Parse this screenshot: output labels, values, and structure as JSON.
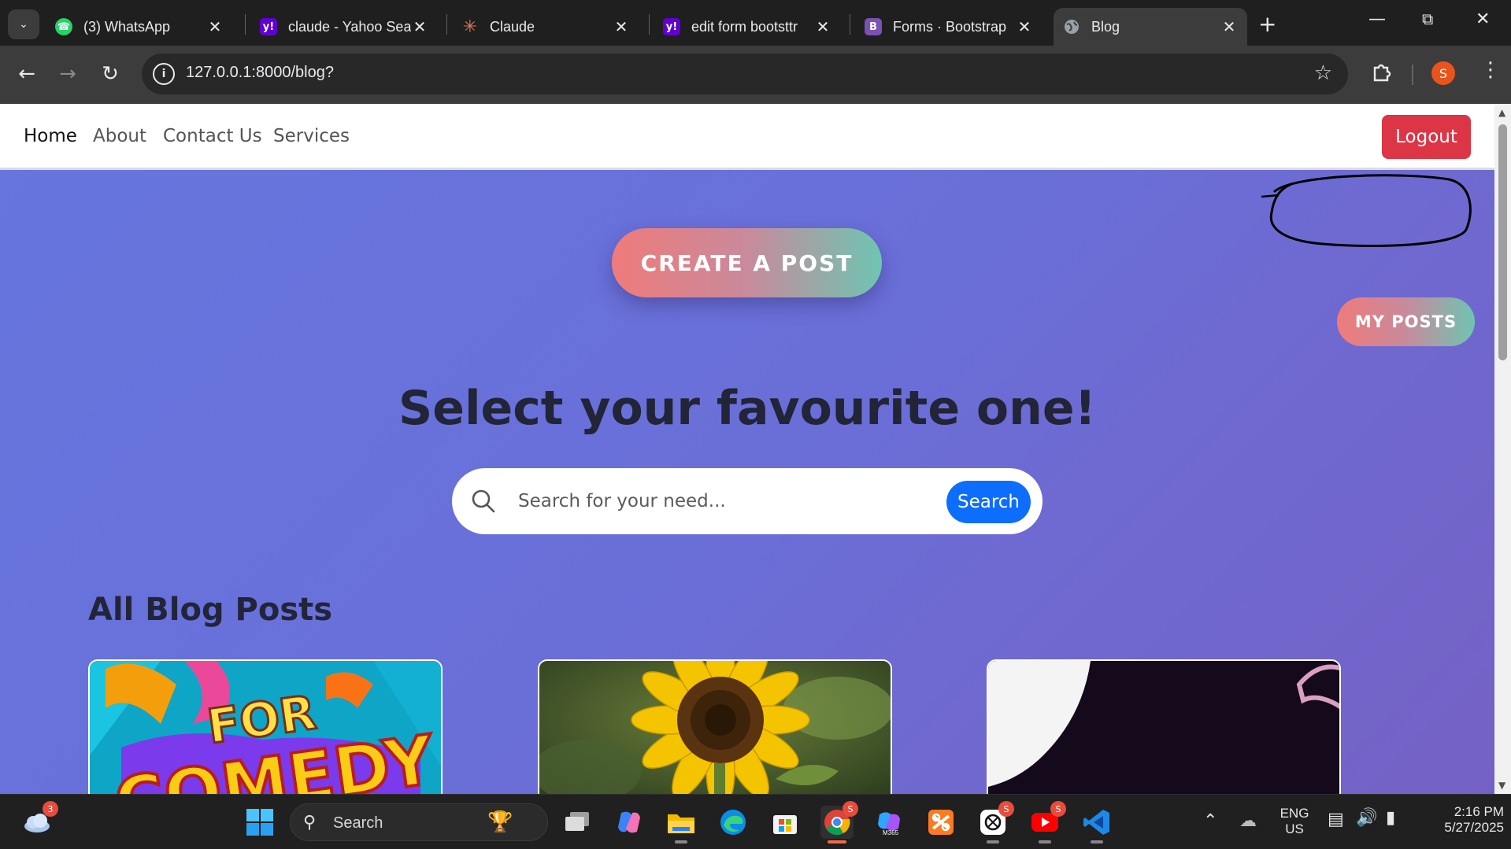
{
  "browser": {
    "tabs": [
      {
        "title": "(3) WhatsApp",
        "icon": "whatsapp-icon",
        "active": false
      },
      {
        "title": "claude - Yahoo Sea",
        "icon": "yahoo-icon",
        "active": false
      },
      {
        "title": "Claude",
        "icon": "claude-icon",
        "active": false
      },
      {
        "title": "edit form bootsttr",
        "icon": "yahoo-icon",
        "active": false
      },
      {
        "title": "Forms · Bootstrap",
        "icon": "bootstrap-icon",
        "active": false
      },
      {
        "title": "Blog",
        "icon": "globe-icon",
        "active": true
      }
    ],
    "url": "127.0.0.1:8000/blog?",
    "profile_initial": "S"
  },
  "page": {
    "nav": {
      "links": [
        "Home",
        "About",
        "Contact Us",
        "Services"
      ],
      "logout_label": "Logout"
    },
    "create_post_label": "CREATE A POST",
    "my_posts_label": "MY POSTS",
    "headline": "Select your favourite one!",
    "search": {
      "placeholder": "Search for your need...",
      "button_label": "Search"
    },
    "section_title": "All Blog Posts",
    "posts": [
      {
        "image": "comedy-poster-image",
        "image_text": [
          "FOR",
          "COMEDY"
        ]
      },
      {
        "image": "sunflower-image"
      },
      {
        "image": "dark-abstract-image"
      }
    ]
  },
  "taskbar": {
    "weather_badge": "3",
    "search_label": "Search",
    "chrome_badge": "S",
    "chatgpt_badge": "S",
    "youtube_badge": "S",
    "m365_label": "M365",
    "lang_line1": "ENG",
    "lang_line2": "US",
    "time": "2:16 PM",
    "date": "5/27/2025"
  },
  "colors": {
    "logout": "#dc3545",
    "search_button": "#0d6efd",
    "gradient_start": "#ef7b7b",
    "gradient_end": "#6ec5b2",
    "page_bg": "#6a6fd8"
  }
}
